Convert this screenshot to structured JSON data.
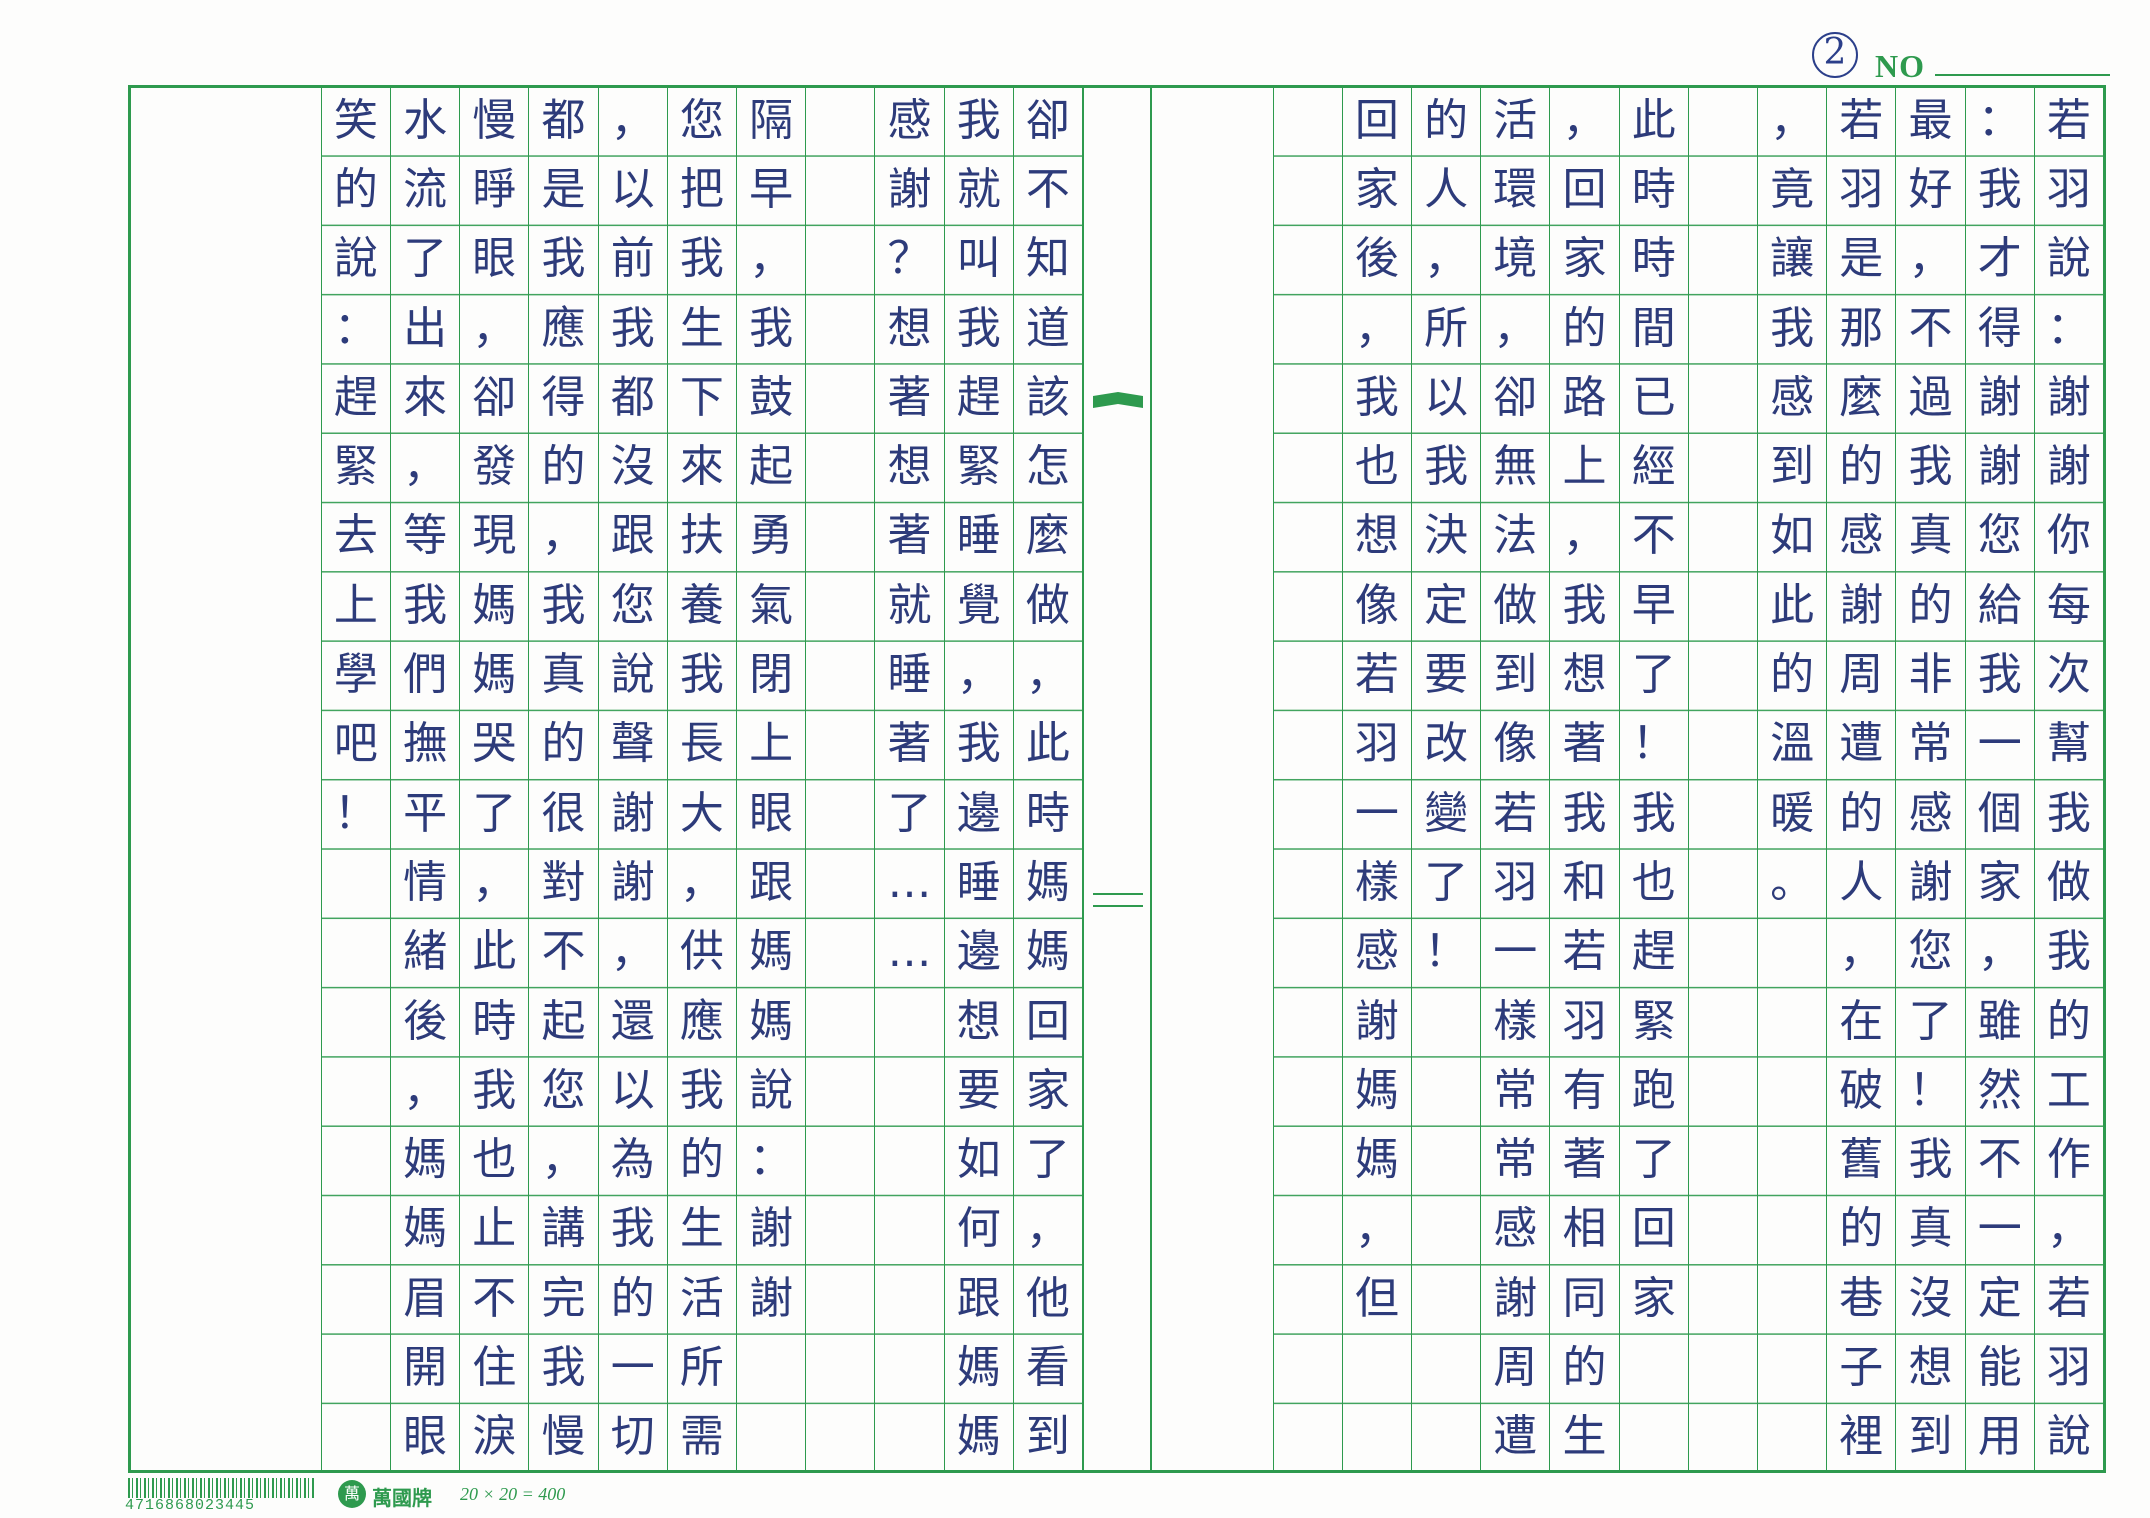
{
  "header": {
    "page_number": "2",
    "no_label": "NO"
  },
  "footer": {
    "barcode_number": "4716868023445",
    "brand_icon": "萬",
    "brand": "萬國牌",
    "size_label": "20 × 20 = 400"
  },
  "right_page_columns": [
    "若羽說：謝謝你每次幫我做我的工作，若羽說",
    "：我才得謝謝您給我一個家，雖然不一定能用",
    "最好，不過我真的非常感謝您了！我真沒想到",
    "若羽是那麼的感謝周遭的人，在破舊的巷子裡",
    "，竟讓我感到如此的溫暖。",
    "",
    "此時時間已經不早了！我也趕緊跑了回家",
    "，回家的路上，我想著我和若羽有著相同的生",
    "活環境，卻無法做到像若羽一樣常常感謝周遭",
    "的人，所以我決定要改變了！",
    "回家後，我也想像若羽一樣感謝媽媽，但",
    ""
  ],
  "left_page_columns": [
    "卻不知道該怎麼做，此時媽媽回家了，他看到",
    "我就叫我趕緊睡覺，我邊睡邊想要如何跟媽媽",
    "感謝？想著想著就睡著了……",
    "",
    "隔早，我鼓起勇氣閉上眼跟媽媽說：謝謝",
    "您把我生下來扶養我長大，供應我的生活所需",
    "，以前我都沒跟您說聲謝謝，還以為我的一切",
    "都是我應得的，我真的很對不起您，講完我慢",
    "慢睜眼，卻發現媽媽哭了，此時我也止不住淚",
    "水流了出來，等我們撫平情緒後，媽媽眉開眼",
    "笑的說：趕緊去上學吧！"
  ]
}
